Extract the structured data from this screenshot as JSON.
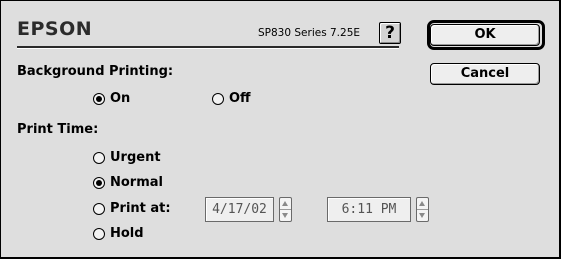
{
  "header": {
    "logo_text": "EPSON",
    "series_text": "SP830 Series 7.25E",
    "help_label": "?",
    "ok_label": "OK",
    "cancel_label": "Cancel"
  },
  "background_printing": {
    "title": "Background Printing:",
    "options": [
      {
        "label": "On",
        "selected": true
      },
      {
        "label": "Off",
        "selected": false
      }
    ]
  },
  "print_time": {
    "title": "Print Time:",
    "options": [
      {
        "label": "Urgent",
        "selected": false
      },
      {
        "label": "Normal",
        "selected": true
      },
      {
        "label": "Print at:",
        "selected": false
      },
      {
        "label": "Hold",
        "selected": false
      }
    ],
    "date_value": "4/17/02",
    "time_value": "6:11 PM"
  },
  "colors": {
    "dialog_bg": "#dedede",
    "field_text": "#555555"
  },
  "icons": {
    "help": "question-mark-icon",
    "stepper_up": "triangle-up-icon",
    "stepper_down": "triangle-down-icon"
  }
}
